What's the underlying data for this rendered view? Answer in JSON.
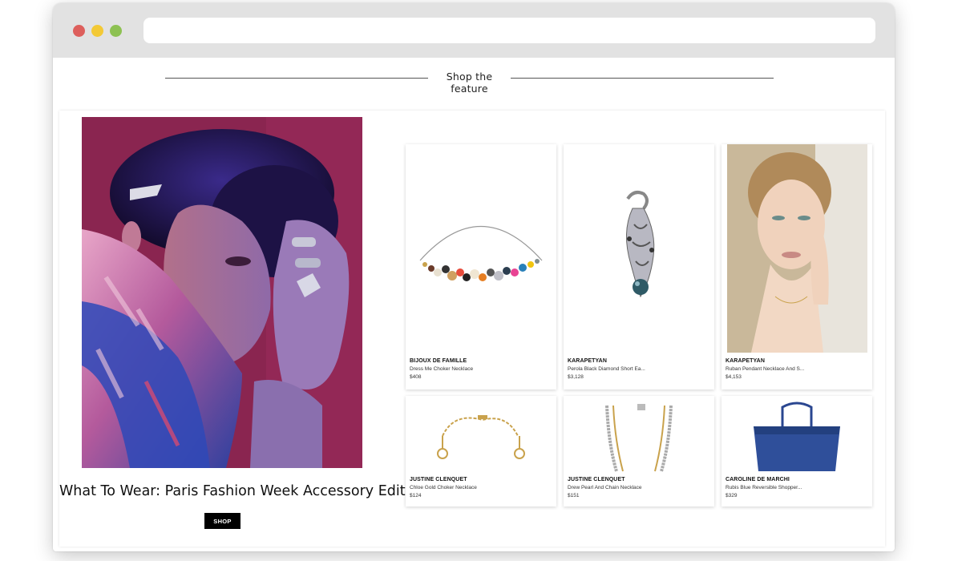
{
  "feature": {
    "title": "Shop the feature"
  },
  "hero": {
    "image_label": "fashion-editorial-photo",
    "title": "What To Wear: Paris Fashion Week Accessory Edit",
    "button_label": "SHOP"
  },
  "products": [
    {
      "brand": "BIJOUX DE FAMILLE",
      "name": "Dress Me Choker Necklace",
      "price": "$408"
    },
    {
      "brand": "KARAPETYAN",
      "name": "Perola Black Diamond Short Ea...",
      "price": "$3,128"
    },
    {
      "brand": "KARAPETYAN",
      "name": "Ruban Pendant Necklace And S...",
      "price": "$4,153"
    },
    {
      "brand": "JUSTINE CLENQUET",
      "name": "Chloe Gold Choker Necklace",
      "price": "$124"
    },
    {
      "brand": "JUSTINE CLENQUET",
      "name": "Drew Pearl And Chain Necklace",
      "price": "$151"
    },
    {
      "brand": "CAROLINE DE MARCHI",
      "name": "Rubis Blue Reversible Shopper...",
      "price": "$329"
    }
  ],
  "colors": {
    "hero_background": "#8c2450",
    "button": "#000000",
    "chrome": "#e2e2e2",
    "window_close": "#dd5f5c",
    "window_minimize": "#f3c936",
    "window_maximize": "#8dc152"
  }
}
